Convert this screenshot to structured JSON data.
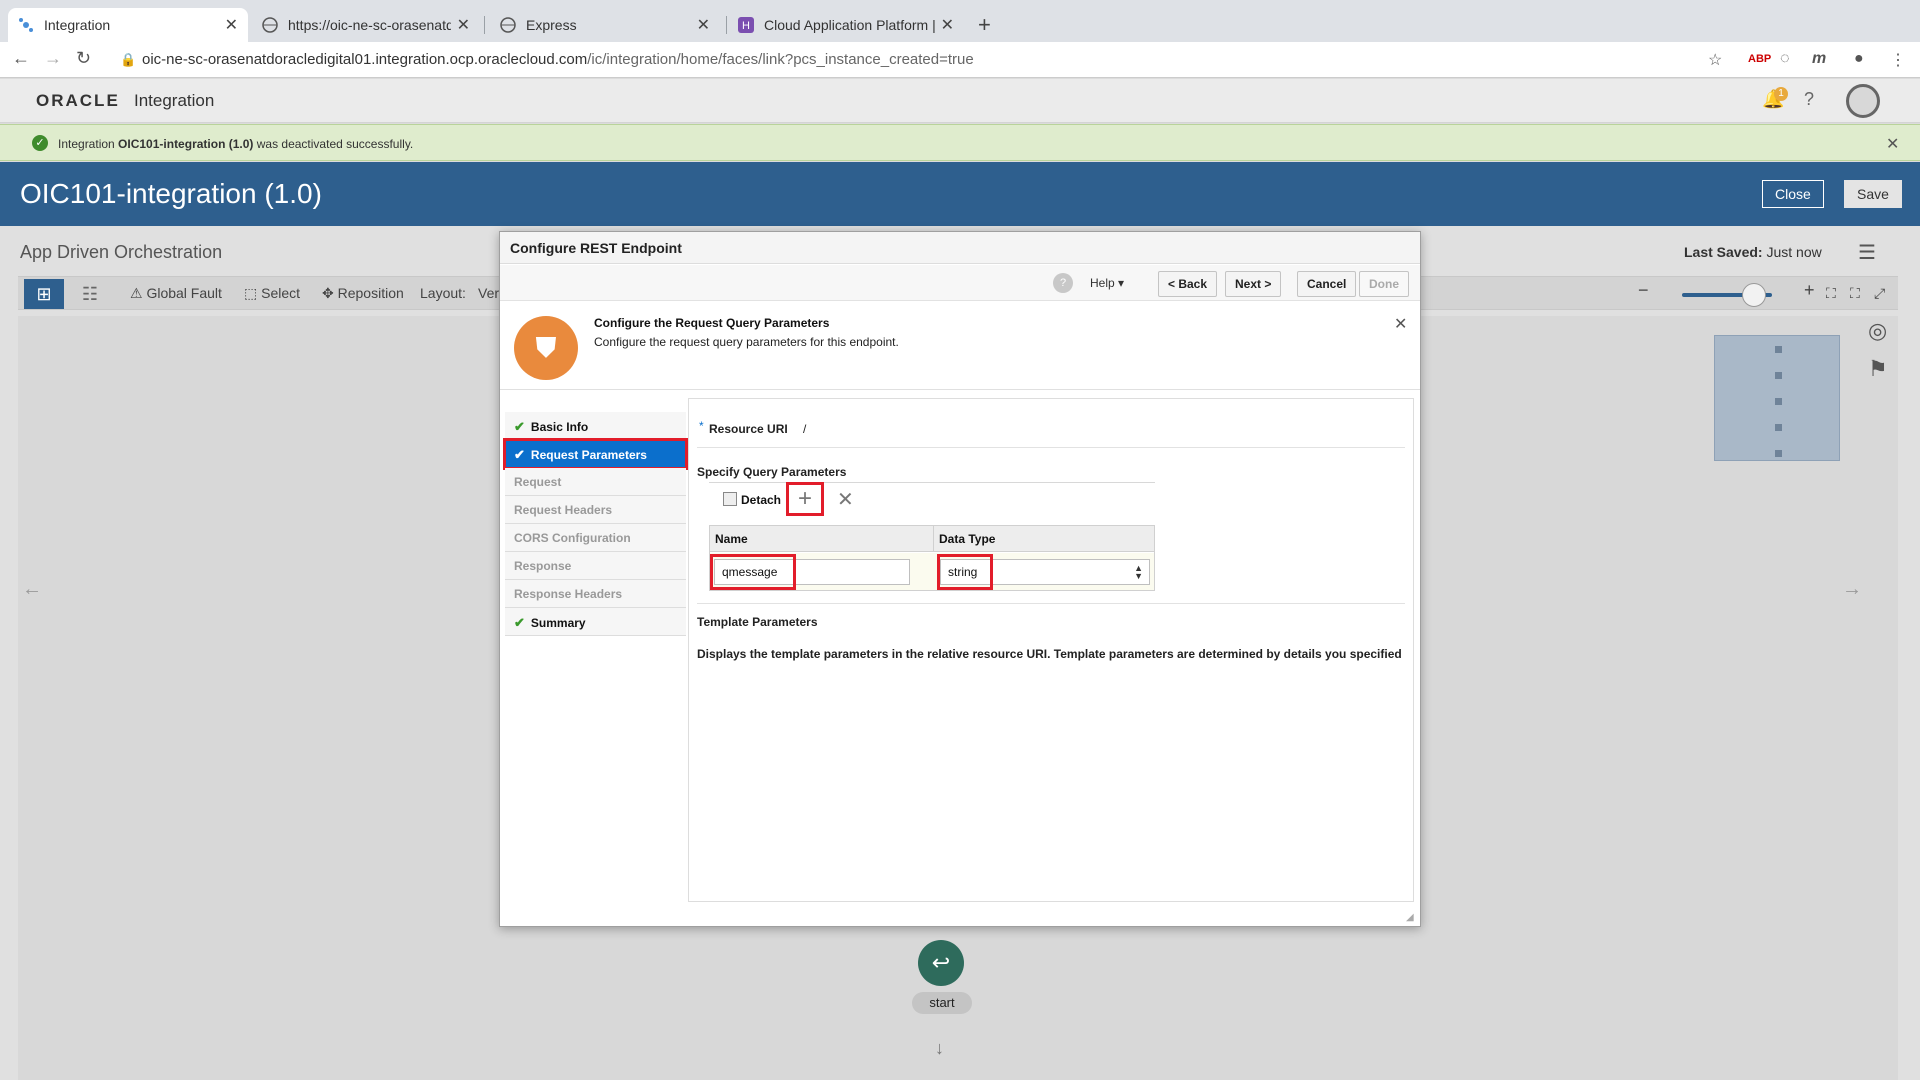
{
  "browser": {
    "tabs": [
      {
        "title": "Integration",
        "active": true
      },
      {
        "title": "https://oic-ne-sc-orasenatdora",
        "active": false
      },
      {
        "title": "Express",
        "active": false
      },
      {
        "title": "Cloud Application Platform | H",
        "active": false
      }
    ],
    "url_host": "oic-ne-sc-orasenatdoracledigital01.integration.ocp.oraclecloud.com",
    "url_path": "/ic/integration/home/faces/link?pcs_instance_created=true"
  },
  "app_header": {
    "brand": "ORACLE",
    "product": "Integration",
    "notification_count": "1"
  },
  "banner": {
    "prefix": "Integration ",
    "integration": "OIC101-integration (1.0)",
    "suffix": " was deactivated successfully."
  },
  "titlebar": {
    "title": "OIC101-integration (1.0)",
    "close_label": "Close",
    "save_label": "Save"
  },
  "canvas": {
    "subtitle": "App Driven Orchestration",
    "last_saved_label": "Last Saved:",
    "last_saved_value": "Just now",
    "toolbar": {
      "global_fault": "Global Fault",
      "select": "Select",
      "reposition": "Reposition",
      "layout": "Layout:",
      "layout_value": "Ver"
    },
    "start_label": "start"
  },
  "dialog": {
    "title": "Configure REST Endpoint",
    "help_label": "Help",
    "back_label": "< Back",
    "next_label": "Next >",
    "cancel_label": "Cancel",
    "done_label": "Done",
    "header_title": "Configure the Request Query Parameters",
    "header_desc": "Configure the request query parameters for this endpoint.",
    "steps": [
      {
        "label": "Basic Info",
        "state": "done"
      },
      {
        "label": "Request Parameters",
        "state": "current"
      },
      {
        "label": "Request",
        "state": "todo"
      },
      {
        "label": "Request Headers",
        "state": "todo"
      },
      {
        "label": "CORS Configuration",
        "state": "todo"
      },
      {
        "label": "Response",
        "state": "todo"
      },
      {
        "label": "Response Headers",
        "state": "todo"
      },
      {
        "label": "Summary",
        "state": "done"
      }
    ],
    "resource_uri_label": "Resource URI",
    "resource_uri_value": "/",
    "query_section": "Specify Query Parameters",
    "detach_label": "Detach",
    "columns": {
      "name": "Name",
      "type": "Data Type"
    },
    "rows": [
      {
        "name": "qmessage",
        "type": "string"
      }
    ],
    "template_section": "Template Parameters",
    "template_desc": "Displays the template parameters in the relative resource URI. Template parameters are determined by details you specified"
  },
  "colors": {
    "accent": "#2e5f8e",
    "selected_step": "#0b6fcc",
    "highlight": "#e21d2a",
    "success": "#3f8b2c"
  }
}
